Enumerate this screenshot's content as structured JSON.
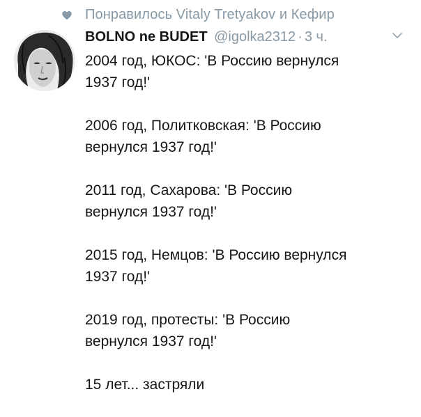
{
  "social_context": {
    "icon": "heart-icon",
    "text": "Понравилось Vitaly Tretyakov и Кефир"
  },
  "tweet": {
    "author_name": "BOLNO ne BUDET",
    "handle": "@igolka2312",
    "separator": "·",
    "time": "3 ч.",
    "paragraphs": [
      "2004 год, ЮКОС: 'В Россию вернулся\n1937 год!'",
      "2006 год, Политковская: 'В Россию\nвернулся 1937 год!'",
      "2011 год, Сахарова: 'В Россию\nвернулся 1937 год!'",
      "2015 год, Немцов: 'В Россию вернулся\n1937 год!'",
      "2019 год, протесты: 'В Россию\nвернулся 1937 год!'",
      "15 лет... застряли"
    ]
  },
  "colors": {
    "text": "#14171a",
    "secondary": "#8899a6"
  }
}
